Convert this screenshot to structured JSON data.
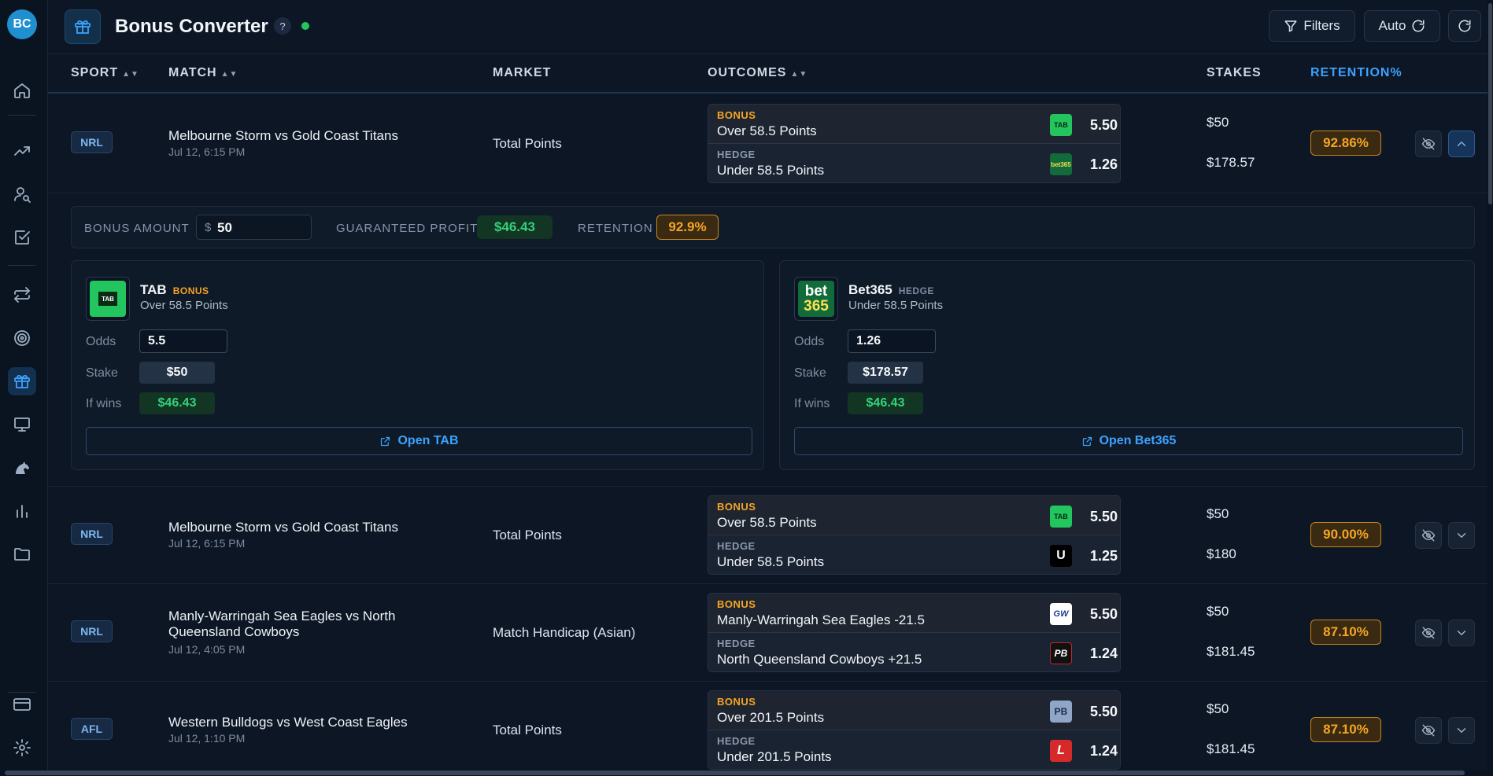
{
  "app": {
    "logo": "BC",
    "title": "Bonus Converter",
    "help": "?"
  },
  "header": {
    "filters_label": "Filters",
    "auto_label": "Auto"
  },
  "sidebar": {
    "items": [
      {
        "name": "home-icon"
      },
      {
        "name": "trending-icon"
      },
      {
        "name": "user-search-icon"
      },
      {
        "name": "checklist-icon"
      },
      {
        "name": "arrows-swap-icon"
      },
      {
        "name": "target-icon"
      },
      {
        "name": "gift-icon",
        "active": true
      },
      {
        "name": "monitor-icon"
      },
      {
        "name": "horse-icon"
      },
      {
        "name": "bar-chart-icon"
      },
      {
        "name": "folder-icon"
      },
      {
        "name": "card-icon"
      },
      {
        "name": "gear-icon"
      }
    ]
  },
  "columns": {
    "sport": "SPORT",
    "match": "MATCH",
    "market": "MARKET",
    "outcomes": "OUTCOMES",
    "stakes": "STAKES",
    "retention": "RETENTION%"
  },
  "rows": [
    {
      "sport": "NRL",
      "match": "Melbourne Storm vs Gold Coast Titans",
      "date": "Jul 12, 6:15 PM",
      "market": "Total Points",
      "bonus": {
        "tag": "BONUS",
        "selection": "Over 58.5 Points",
        "odds": "5.50",
        "book_logo": "TAB",
        "stake": "$50"
      },
      "hedge": {
        "tag": "HEDGE",
        "selection": "Under 58.5 Points",
        "odds": "1.26",
        "book_logo": "bet365",
        "stake": "$178.57"
      },
      "retention": "92.86%"
    },
    {
      "sport": "NRL",
      "match": "Melbourne Storm vs Gold Coast Titans",
      "date": "Jul 12, 6:15 PM",
      "market": "Total Points",
      "bonus": {
        "tag": "BONUS",
        "selection": "Over 58.5 Points",
        "odds": "5.50",
        "book_logo": "TAB",
        "stake": "$50"
      },
      "hedge": {
        "tag": "HEDGE",
        "selection": "Under 58.5 Points",
        "odds": "1.25",
        "book_logo": "U",
        "stake": "$180"
      },
      "retention": "90.00%"
    },
    {
      "sport": "NRL",
      "match": "Manly-Warringah Sea Eagles vs North Queensland Cowboys",
      "date": "Jul 12, 4:05 PM",
      "market": "Match Handicap (Asian)",
      "bonus": {
        "tag": "BONUS",
        "selection": "Manly-Warringah Sea Eagles -21.5",
        "odds": "5.50",
        "book_logo": "GW",
        "stake": "$50"
      },
      "hedge": {
        "tag": "HEDGE",
        "selection": "North Queensland Cowboys +21.5",
        "odds": "1.24",
        "book_logo": "PB",
        "stake": "$181.45"
      },
      "retention": "87.10%"
    },
    {
      "sport": "AFL",
      "match": "Western Bulldogs vs West Coast Eagles",
      "date": "Jul 12, 1:10 PM",
      "market": "Total Points",
      "bonus": {
        "tag": "BONUS",
        "selection": "Over 201.5 Points",
        "odds": "5.50",
        "book_logo": "PB",
        "stake": "$50"
      },
      "hedge": {
        "tag": "HEDGE",
        "selection": "Under 201.5 Points",
        "odds": "1.24",
        "book_logo": "L",
        "stake": "$181.45"
      },
      "retention": "87.10%"
    }
  ],
  "calculator": {
    "bonus_amount_label": "BONUS AMOUNT",
    "currency": "$",
    "bonus_amount": "50",
    "profit_label": "GUARANTEED PROFIT",
    "profit": "$46.43",
    "retention_label": "RETENTION",
    "retention": "92.9%",
    "odds_label": "Odds",
    "stake_label": "Stake",
    "wins_label": "If wins",
    "bonus_card": {
      "book": "TAB",
      "role": "BONUS",
      "selection": "Over 58.5 Points",
      "odds": "5.5",
      "stake": "$50",
      "wins": "$46.43",
      "open_label": "Open TAB"
    },
    "hedge_card": {
      "book": "Bet365",
      "role": "HEDGE",
      "selection": "Under 58.5 Points",
      "odds": "1.26",
      "stake": "$178.57",
      "wins": "$46.43",
      "open_label": "Open Bet365"
    }
  },
  "colors": {
    "accent": "#3da2ff",
    "bonus": "#f5a524",
    "profit": "#34d27a",
    "status": "#22c55e"
  }
}
